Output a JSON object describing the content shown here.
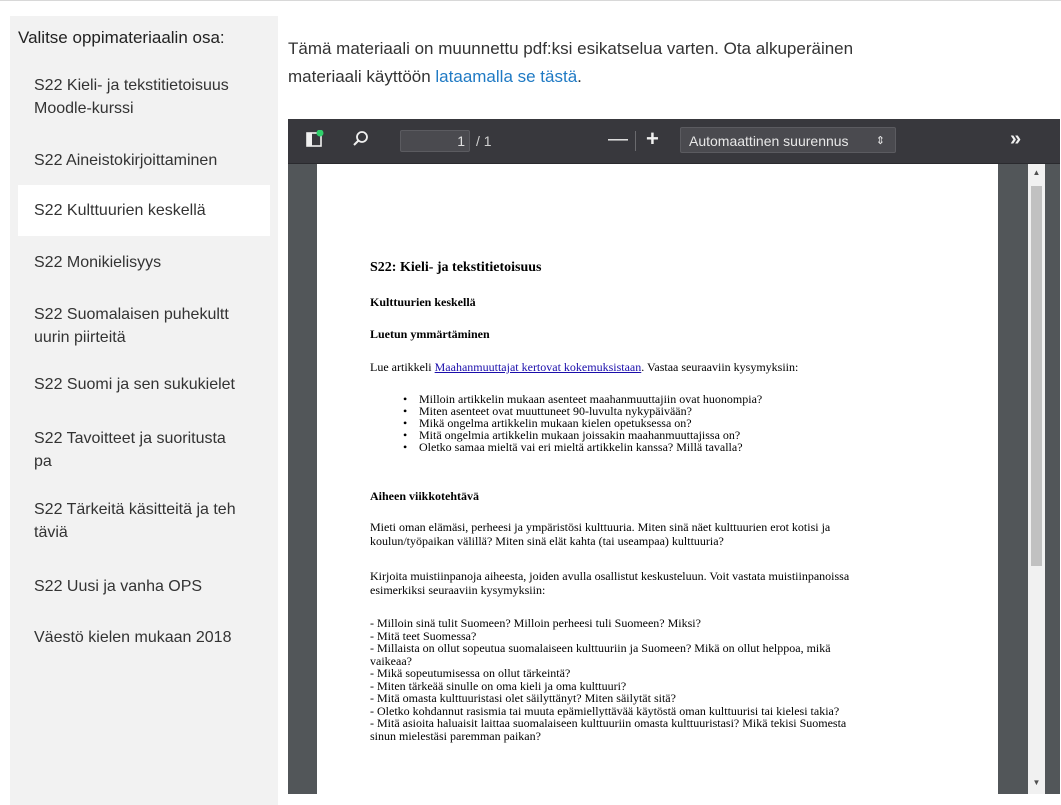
{
  "sidebar": {
    "title": "Valitse oppimateriaalin osa:",
    "items": [
      {
        "line1": "S22 Kieli- ja tekstitietoisuus",
        "line2": "Moodle-kurssi"
      },
      {
        "line1": "S22 Aineistokirjoittaminen",
        "line2": ""
      },
      {
        "line1": "S22 Kulttuurien keskellä",
        "line2": ""
      },
      {
        "line1": "S22 Monikielisyys",
        "line2": ""
      },
      {
        "line1": "S22 Suomalaisen puhekultt",
        "line2": "uurin piirteitä"
      },
      {
        "line1": "S22 Suomi ja sen sukukielet",
        "line2": ""
      },
      {
        "line1": "S22 Tavoitteet ja suoritusta",
        "line2": "pa"
      },
      {
        "line1": "S22 Tärkeitä käsitteitä ja teh",
        "line2": "täviä"
      },
      {
        "line1": "S22 Uusi ja vanha OPS",
        "line2": ""
      },
      {
        "line1": "Väestö kielen mukaan 2018",
        "line2": ""
      }
    ],
    "active_index": 2
  },
  "intro": {
    "text_line1": "Tämä materiaali on muunnettu pdf:ksi esikatselua varten. Ota alkuperäinen",
    "text_line2_prefix": "materiaali käyttöön ",
    "link_text": "lataamalla se tästä",
    "suffix": "."
  },
  "viewer": {
    "page_number": "1",
    "page_count": "/ 1",
    "zoom_label": "Automaattinen suurennus",
    "icons": [
      "sidebar-toggle-icon",
      "search-icon",
      "zoom-out-icon",
      "zoom-in-icon",
      "dropdown-arrows-icon",
      "tools-menu-icon"
    ]
  },
  "document": {
    "title": "S22: Kieli- ja tekstitietoisuus",
    "section1": "Kulttuurien keskellä",
    "section2": "Luetun ymmärtäminen",
    "read_prefix": "Lue artikkeli ",
    "read_link": "Maahanmuuttajat kertovat kokemuksistaan",
    "read_suffix": ". Vastaa seuraaviin kysymyksiin:",
    "questions": [
      "Milloin artikkelin mukaan asenteet maahanmuuttajiin ovat huonompia?",
      "Miten asenteet ovat muuttuneet 90-luvulta nykypäivään?",
      "Mikä ongelma artikkelin mukaan kielen opetuksessa on?",
      "Mitä ongelmia artikkelin mukaan joissakin maahanmuuttajissa on?",
      "Oletko samaa mieltä vai eri mieltä artikkelin kanssa? Millä tavalla?"
    ],
    "section3": "Aiheen viikkotehtävä",
    "para1_line1": "Mieti oman elämäsi, perheesi ja ympäristösi kulttuuria. Miten sinä näet kulttuurien erot kotisi ja",
    "para1_line2": "koulun/työpaikan välillä? Miten sinä elät kahta (tai useampaa) kulttuuria?",
    "para2_line1": "Kirjoita muistiinpanoja aiheesta, joiden avulla osallistut keskusteluun. Voit vastata muistiinpanoissa",
    "para2_line2": "esimerkiksi seuraaviin kysymyksiin:",
    "dash_lines": [
      "- Milloin sinä tulit Suomeen? Milloin perheesi tuli Suomeen? Miksi?",
      "- Mitä teet Suomessa?",
      "- Millaista on ollut sopeutua suomalaiseen kulttuuriin ja Suomeen? Mikä on ollut helppoa, mikä",
      "vaikeaa?",
      "- Mikä sopeutumisessa on ollut tärkeintä?",
      "- Miten tärkeää sinulle on oma kieli ja oma kulttuuri?",
      "- Mitä omasta kulttuuristasi olet säilyttänyt? Miten säilytät sitä?",
      "- Oletko kohdannut rasismia tai muuta epämiellyttävää käytöstä oman kulttuurisi tai kielesi takia?",
      "- Mitä asioita haluaisit laittaa suomalaiseen kulttuuriin omasta kulttuuristasi? Mikä tekisi Suomesta",
      "sinun mielestäsi paremman paikan?"
    ]
  },
  "colors": {
    "sidebar_bg": "#f2f2f2",
    "link": "#1f7ac4",
    "toolbar_bg": "#38383d",
    "notification_dot": "#2fd06b"
  }
}
